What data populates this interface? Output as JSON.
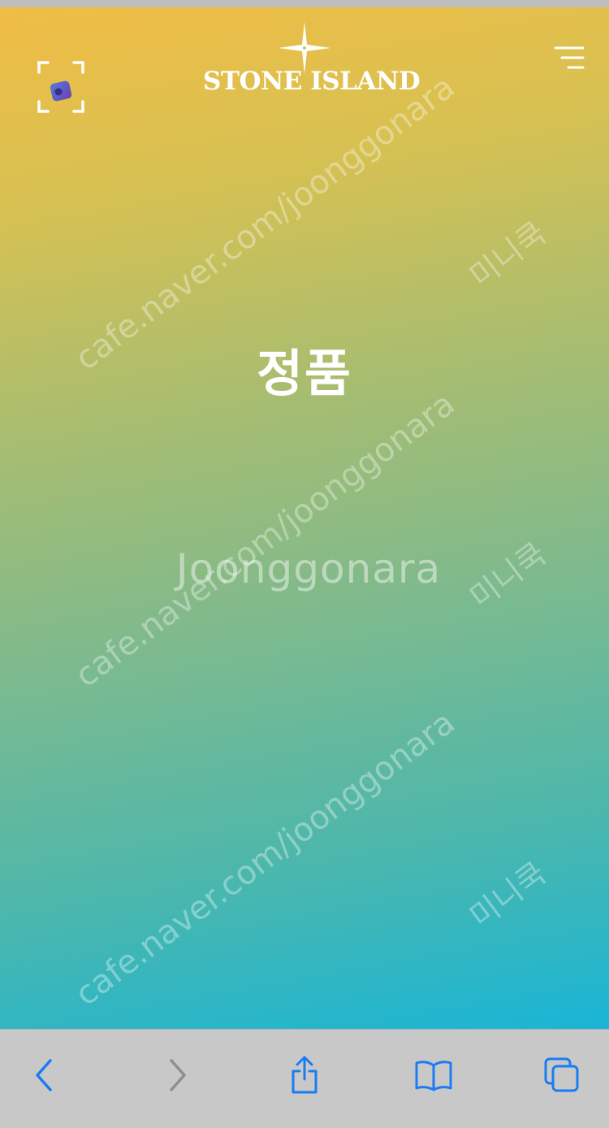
{
  "brand": {
    "logo_text": "STONE ISLAND"
  },
  "main": {
    "heading": "정품"
  },
  "watermarks": {
    "url_text": "cafe.naver.com/joonggonara",
    "korean_text": "미니쿡",
    "logo_text": "Joonggonara"
  },
  "toolbar": {
    "buttons": [
      {
        "name": "back",
        "icon": "chevron-left-icon",
        "enabled": true
      },
      {
        "name": "forward",
        "icon": "chevron-right-icon",
        "enabled": false
      },
      {
        "name": "share",
        "icon": "share-icon",
        "enabled": true
      },
      {
        "name": "bookmarks",
        "icon": "book-icon",
        "enabled": true
      },
      {
        "name": "tabs",
        "icon": "tabs-icon",
        "enabled": true
      }
    ]
  },
  "colors": {
    "gradient_top": "#f0bd45",
    "gradient_bottom": "#19b5d6",
    "toolbar_bg": "#c8c8c8",
    "accent": "#1b7cf2",
    "disabled": "#8e8e93"
  }
}
